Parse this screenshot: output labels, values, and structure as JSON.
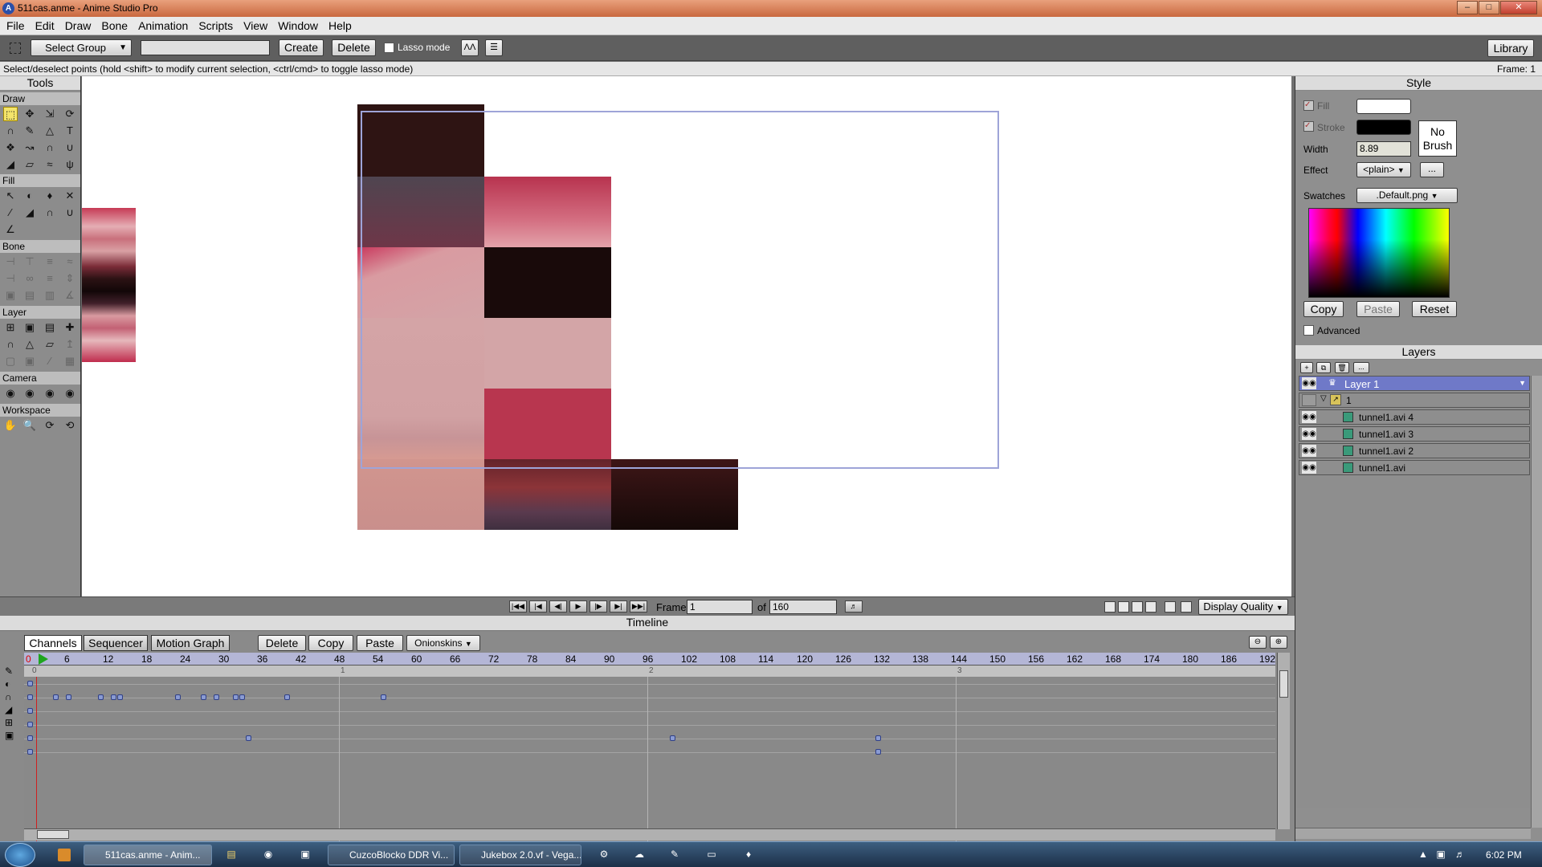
{
  "window": {
    "title": "511cas.anme - Anime Studio Pro",
    "app_icon": "A"
  },
  "menu": [
    "File",
    "Edit",
    "Draw",
    "Bone",
    "Animation",
    "Scripts",
    "View",
    "Window",
    "Help"
  ],
  "toolbar": {
    "select_group": "Select Group",
    "group_name_value": "",
    "create": "Create",
    "delete": "Delete",
    "lasso_mode": "Lasso mode",
    "library": "Library"
  },
  "status": {
    "hint": "Select/deselect points (hold <shift> to modify current selection, <ctrl/cmd> to toggle lasso mode)",
    "frame": "Frame: 1"
  },
  "tools": {
    "title": "Tools",
    "sections": {
      "draw": "Draw",
      "fill": "Fill",
      "bone": "Bone",
      "layer": "Layer",
      "camera": "Camera",
      "workspace": "Workspace"
    }
  },
  "style": {
    "title": "Style",
    "fill_label": "Fill",
    "stroke_label": "Stroke",
    "width_label": "Width",
    "width_value": "8.89",
    "effect_label": "Effect",
    "effect_value": "<plain>",
    "effect_more": "...",
    "brush_label": "No Brush",
    "swatches_label": "Swatches",
    "swatches_value": ".Default.png",
    "copy": "Copy",
    "paste": "Paste",
    "reset": "Reset",
    "advanced": "Advanced",
    "fill_color": "#ffffff",
    "stroke_color": "#000000"
  },
  "layers": {
    "title": "Layers",
    "more": "...",
    "items": [
      {
        "name": "Layer 1",
        "selected": true
      },
      {
        "name": "1"
      },
      {
        "name": "tunnel1.avi 4"
      },
      {
        "name": "tunnel1.avi 3"
      },
      {
        "name": "tunnel1.avi 2"
      },
      {
        "name": "tunnel1.avi"
      }
    ]
  },
  "playback": {
    "frame_label": "Frame",
    "frame_value": "1",
    "of_label": "of",
    "total_frames": "160",
    "display_quality": "Display Quality"
  },
  "timeline": {
    "title": "Timeline",
    "tabs": [
      "Channels",
      "Sequencer",
      "Motion Graph"
    ],
    "delete": "Delete",
    "copy": "Copy",
    "paste": "Paste",
    "onionskins": "Onionskins",
    "ruler": [
      "0",
      "6",
      "12",
      "18",
      "24",
      "30",
      "36",
      "42",
      "48",
      "54",
      "60",
      "66",
      "72",
      "78",
      "84",
      "90",
      "96",
      "102",
      "108",
      "114",
      "120",
      "126",
      "132",
      "138",
      "144",
      "150",
      "156",
      "162",
      "168",
      "174",
      "180",
      "186",
      "192"
    ],
    "seconds": [
      "0",
      "1",
      "2",
      "3"
    ]
  },
  "taskbar": {
    "tasks": [
      "511cas.anme - Anim...",
      "CuzcoBlocko DDR Vi...",
      "Jukebox 2.0.vf - Vega..."
    ],
    "clock": "6:02 PM"
  },
  "colors": {
    "accent": "#7884d0",
    "canvas_bg": "#ffffff",
    "panel_bg": "#8c8c8c"
  }
}
